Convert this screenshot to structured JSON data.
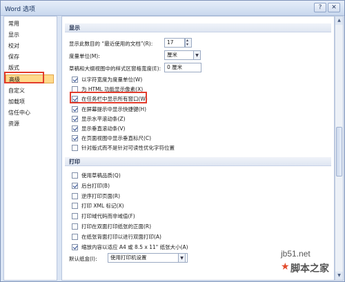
{
  "window": {
    "title": "Word 选项",
    "help_glyph": "?",
    "close_glyph": "✕"
  },
  "nav": {
    "items": [
      "常用",
      "显示",
      "校对",
      "保存",
      "版式",
      "高级",
      "自定义",
      "加载项",
      "信任中心",
      "资源"
    ],
    "selected_index": 5
  },
  "display": {
    "section_title": "显示",
    "recent_docs_label": "显示此数目的 “最近使用的文档”(R):",
    "recent_docs_value": "17",
    "units_label": "度量单位(M):",
    "units_value": "厘米",
    "style_width_label": "草稿和大纲视图中的样式区窗格宽度(E):",
    "style_width_value": "0 厘米",
    "options": [
      {
        "label": "以字符宽度为度量单位(W)",
        "checked": true
      },
      {
        "label": "为 HTML 功能显示像素(X)",
        "checked": false
      },
      {
        "label": "在任务栏中显示所有窗口(W)",
        "checked": true
      },
      {
        "label": "在屏幕提示中显示快捷键(H)",
        "checked": true
      },
      {
        "label": "显示水平滚动条(Z)",
        "checked": true
      },
      {
        "label": "显示垂直滚动条(V)",
        "checked": true
      },
      {
        "label": "在页面视图中显示垂直标尺(C)",
        "checked": true
      },
      {
        "label": "针对版式而不是针对可读性优化字符位置",
        "checked": false
      }
    ]
  },
  "print": {
    "section_title": "打印",
    "options": [
      {
        "label": "使用草稿品质(Q)",
        "checked": false
      },
      {
        "label": "后台打印(B)",
        "checked": true
      },
      {
        "label": "逆序打印页面(R)",
        "checked": false
      },
      {
        "label": "打印 XML 标记(X)",
        "checked": false
      },
      {
        "label": "打印域代码而非域值(F)",
        "checked": false
      },
      {
        "label": "打印在双面打印纸张的正面(R)",
        "checked": false
      },
      {
        "label": "在纸张背面打印以进行双面打印(A)",
        "checked": false
      },
      {
        "label": "缩放内容以适应 A4 或 8.5 x 11\" 纸张大小(A)",
        "checked": true
      }
    ],
    "tray_label": "默认纸盒(I):",
    "tray_value": "使用打印机设置"
  },
  "watermark": {
    "url": "jb51.net",
    "name": "脚本之家",
    "logo_glyph": "★"
  },
  "colors": {
    "highlight": "#e23c2c",
    "selected_bg": "#ffd98a"
  }
}
